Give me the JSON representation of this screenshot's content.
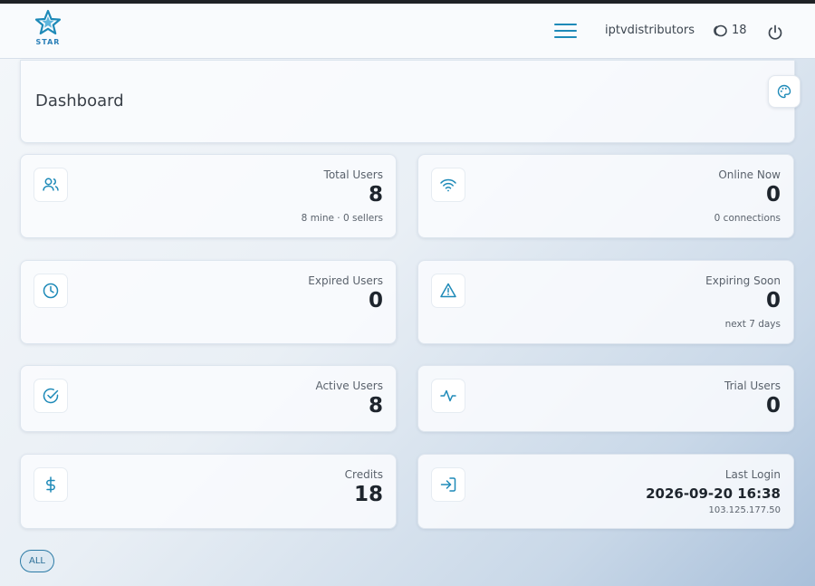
{
  "header": {
    "logo_text": "STAR",
    "username": "iptvdistributors",
    "credits": "18"
  },
  "dashboard": {
    "title": "Dashboard"
  },
  "cards": [
    {
      "id": "total-users",
      "label": "Total Users",
      "value": "8",
      "sub": "8 mine · 0 sellers",
      "icon": "users-icon"
    },
    {
      "id": "online-now",
      "label": "Online Now",
      "value": "0",
      "sub": "0 connections",
      "icon": "wifi-icon"
    },
    {
      "id": "expired-users",
      "label": "Expired Users",
      "value": "0",
      "sub": "",
      "icon": "clock-icon"
    },
    {
      "id": "expiring-soon",
      "label": "Expiring Soon",
      "value": "0",
      "sub": "next 7 days",
      "icon": "warning-icon"
    },
    {
      "id": "active-users",
      "label": "Active Users",
      "value": "8",
      "sub": "",
      "icon": "check-circle-icon"
    },
    {
      "id": "trial-users",
      "label": "Trial Users",
      "value": "0",
      "sub": "",
      "icon": "activity-icon"
    },
    {
      "id": "credits",
      "label": "Credits",
      "value": "18",
      "sub": "",
      "icon": "dollar-icon"
    },
    {
      "id": "last-login",
      "label": "Last Login",
      "value": "2026-09-20 16:38",
      "sub": "103.125.177.50",
      "icon": "login-icon"
    }
  ],
  "filter": {
    "label": "ALL"
  },
  "colors": {
    "accent": "#1e8ab8",
    "text": "#1e252d"
  }
}
